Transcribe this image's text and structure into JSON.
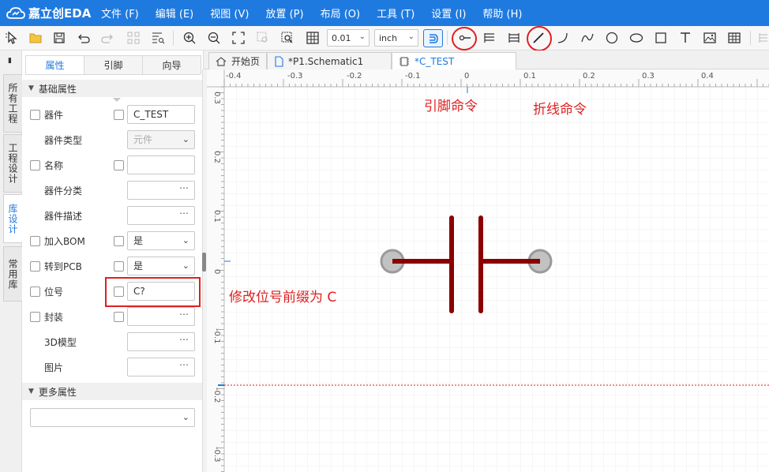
{
  "app": {
    "logo_text": "嘉立创EDA",
    "menu": [
      "文件 (F)",
      "编辑 (E)",
      "视图 (V)",
      "放置 (P)",
      "布局 (O)",
      "工具 (T)",
      "设置 (I)",
      "帮助 (H)"
    ]
  },
  "toolbar": {
    "grid_value": "0.01",
    "unit_value": "inch"
  },
  "vertical_tabs": [
    {
      "label": "所有工程",
      "active": false
    },
    {
      "label": "工程设计",
      "active": false
    },
    {
      "label": "库设计",
      "active": true
    },
    {
      "label": "常用库",
      "active": false
    }
  ],
  "panel": {
    "tabs": [
      "属性",
      "引脚",
      "向导"
    ],
    "basic_section": "基础属性",
    "more_section": "更多属性",
    "rows": [
      {
        "label": "器件",
        "value": "C_TEST"
      },
      {
        "label": "器件类型",
        "value": "元件"
      },
      {
        "label": "名称",
        "value": ""
      },
      {
        "label": "器件分类",
        "value": ""
      },
      {
        "label": "器件描述",
        "value": ""
      },
      {
        "label": "加入BOM",
        "value": "是"
      },
      {
        "label": "转到PCB",
        "value": "是"
      },
      {
        "label": "位号",
        "value": "C?"
      },
      {
        "label": "封装",
        "value": ""
      },
      {
        "label": "3D模型",
        "value": ""
      },
      {
        "label": "图片",
        "value": ""
      }
    ]
  },
  "doc_tabs": [
    "开始页",
    "*P1.Schematic1",
    "*C_TEST"
  ],
  "ruler": {
    "top_ticks": [
      "-0.4",
      "-0.3",
      "-0.2",
      "-0.1",
      "0",
      "0.1",
      "0.2",
      "0.3",
      "0.4"
    ],
    "left_ticks": [
      "0.3",
      "0.2",
      "0.1",
      "0",
      "-0.1",
      "-0.2",
      "-0.3"
    ]
  },
  "annotations": {
    "pin_command": "引脚命令",
    "polyline_command": "折线命令",
    "designator_note": "修改位号前缀为 C"
  },
  "colors": {
    "accent": "#1f7ae0",
    "annotation_red": "#e02020",
    "component_dark_red": "#8b0000",
    "pin_gray": "#a0a0a0"
  }
}
